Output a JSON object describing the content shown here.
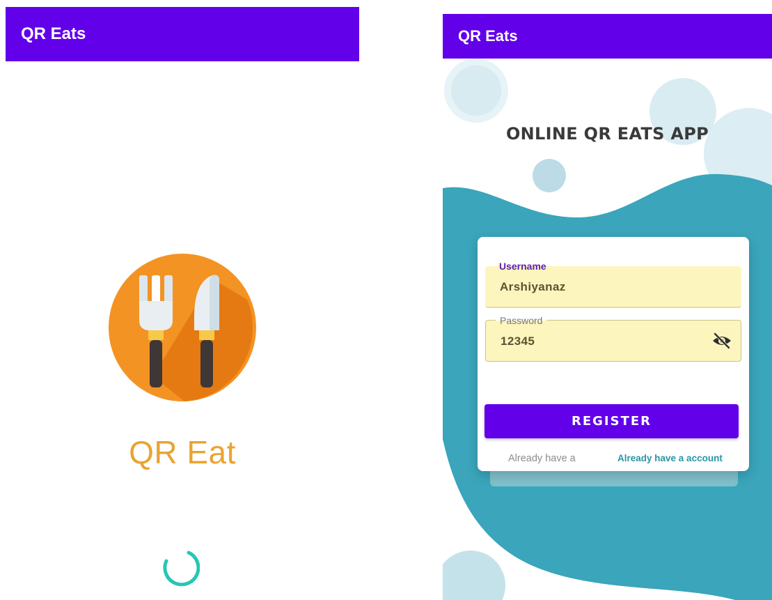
{
  "theme": {
    "primary": "#6200ea",
    "logo_orange": "#f39324",
    "logo_orange_shadow": "#e57a12",
    "splash_text": "#eaa331",
    "spinner": "#26c6b4",
    "teal": "#3aa5bb",
    "field_label": "#5a1fb5",
    "link": "#2a93a8"
  },
  "splash": {
    "app_bar_title": "QR Eats",
    "logo_icon": "fork-knife-icon",
    "app_name": "QR Eat",
    "loading_icon": "loading-spinner-icon"
  },
  "register": {
    "app_bar_title": "QR Eats",
    "heading": "ONLINE QR EATS APP",
    "username": {
      "label": "Username",
      "value": "Arshiyanaz"
    },
    "password": {
      "label": "Password",
      "value": "12345",
      "toggle_icon": "eye-off-icon"
    },
    "register_button": "REGISTER",
    "login_hint": "Already have a",
    "login_link": "Already have a account"
  }
}
